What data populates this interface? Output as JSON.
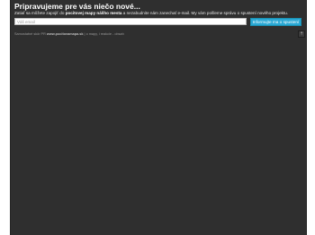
{
  "announcement": {
    "headline": "Pripravujeme pre vás niečo nové...",
    "subtext_before": "Zatiaľ sa môžete zapojiť do ",
    "subtext_bold": "pocitovej mapy nášho mesta",
    "subtext_after": " a nezabudnite nám zanechať e-mail. My vám pošleme správu o spustení nového projektu."
  },
  "signup": {
    "email_placeholder": "Váš email",
    "email_value": "",
    "button_label": "Informujte ma o spustení"
  },
  "footer": {
    "note": "Samostatné skôr PR ",
    "site": "www.pocitovamapa.sk",
    "note_after": " | o mapy, i reakcie - obsah"
  },
  "controls": {
    "scroll_top_icon": "arrow-up-icon",
    "scroll_top_glyph": "⇡"
  },
  "colors": {
    "background": "#2f2f2f",
    "accent": "#2aa8d4"
  }
}
